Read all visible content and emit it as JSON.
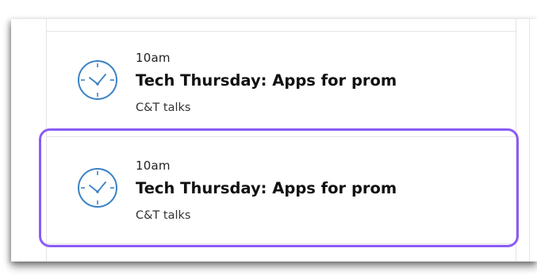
{
  "events": [
    {
      "time": "10am",
      "title": "Tech Thursday: Apps for prom",
      "category": "C&T talks",
      "icon": "clock-icon"
    },
    {
      "time": "10am",
      "title": "Tech Thursday: Apps for prom",
      "category": "C&T talks",
      "icon": "clock-icon",
      "highlighted": true
    }
  ],
  "colors": {
    "icon_blue": "#3b82c4",
    "highlight_purple": "#8b5cf6"
  }
}
